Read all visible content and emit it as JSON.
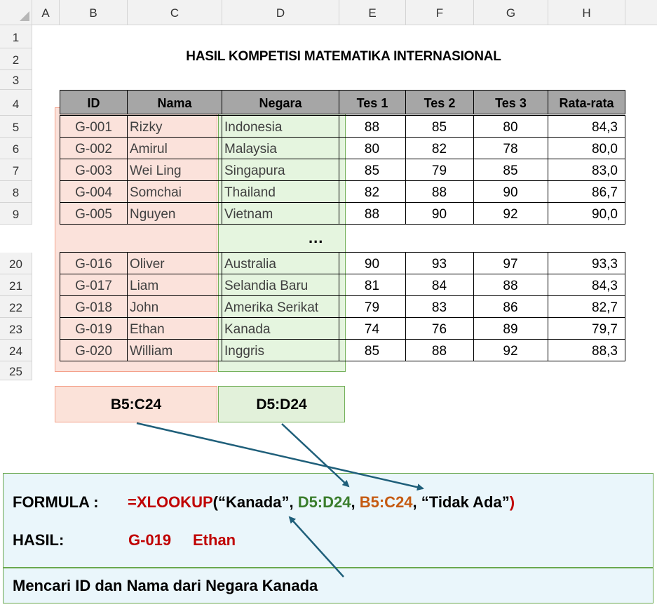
{
  "columns": [
    "A",
    "B",
    "C",
    "D",
    "E",
    "F",
    "G",
    "H"
  ],
  "rows": [
    "1",
    "2",
    "3",
    "4",
    "5",
    "6",
    "7",
    "8",
    "9",
    "20",
    "21",
    "22",
    "23",
    "24",
    "25"
  ],
  "title": "HASIL KOMPETISI MATEMATIKA INTERNASIONAL",
  "table": {
    "headers": [
      "ID",
      "Nama",
      "Negara",
      "Tes 1",
      "Tes 2",
      "Tes 3",
      "Rata-rata"
    ],
    "rows_top": [
      [
        "G-001",
        "Rizky",
        "Indonesia",
        "88",
        "85",
        "80",
        "84,3"
      ],
      [
        "G-002",
        "Amirul",
        "Malaysia",
        "80",
        "82",
        "78",
        "80,0"
      ],
      [
        "G-003",
        "Wei Ling",
        "Singapura",
        "85",
        "79",
        "85",
        "83,0"
      ],
      [
        "G-004",
        "Somchai",
        "Thailand",
        "82",
        "88",
        "90",
        "86,7"
      ],
      [
        "G-005",
        "Nguyen",
        "Vietnam",
        "88",
        "90",
        "92",
        "90,0"
      ]
    ],
    "ellipsis": "...",
    "rows_bottom": [
      [
        "G-016",
        "Oliver",
        "Australia",
        "90",
        "93",
        "97",
        "93,3"
      ],
      [
        "G-017",
        "Liam",
        "Selandia Baru",
        "81",
        "84",
        "88",
        "84,3"
      ],
      [
        "G-018",
        "John",
        "Amerika Serikat",
        "79",
        "83",
        "86",
        "82,7"
      ],
      [
        "G-019",
        "Ethan",
        "Kanada",
        "74",
        "76",
        "89",
        "79,7"
      ],
      [
        "G-020",
        "William",
        "Inggris",
        "85",
        "88",
        "92",
        "88,3"
      ]
    ]
  },
  "range_labels": {
    "return_range": "B5:C24",
    "lookup_range": "D5:D24"
  },
  "panel": {
    "formula_label": "FORMULA :",
    "formula_parts": {
      "fn": "=XLOOKUP",
      "open": "(",
      "arg1": "“Kanada”",
      "sep1": ", ",
      "arg2": "D5:D24",
      "sep2": ", ",
      "arg3": "B5:C24",
      "sep3": ", ",
      "arg4": "“Tidak Ada”",
      "close": ")"
    },
    "result_label": "HASIL:",
    "result_id": "G-019",
    "result_name": "Ethan",
    "description": "Mencari ID dan Nama dari Negara Kanada"
  },
  "colors": {
    "formula_red": "#c00000",
    "green": "#3a7d2c",
    "orange": "#c55a11",
    "arrow": "#1f5f7a",
    "highlight_red": "#f8cbbe",
    "highlight_green": "#d0ecc4",
    "header_gray": "#a6a6a6"
  }
}
